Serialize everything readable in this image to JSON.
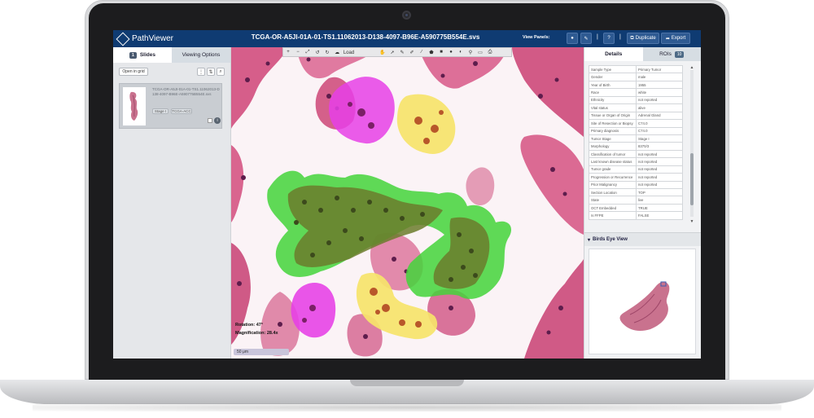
{
  "app": {
    "logo_text": "PathViewer",
    "file_title": "TCGA-OR-A5JI-01A-01-TS1.11062013-D138-4097-B96E-A590775B554E.svs",
    "view_panels_label": "View Panels:",
    "duplicate_label": "Duplicate",
    "export_label": "Export",
    "help_label": "?"
  },
  "left_panel": {
    "tabs": [
      {
        "label": "Slides",
        "badge": "1"
      },
      {
        "label": "Viewing Options"
      }
    ],
    "open_grid_label": "Open in grid",
    "slide": {
      "name": "TCGA-OR-A5JI-01A-01-TS1.11062013-D138-4097-B96E-A590775B554E.svs",
      "tags": [
        "Stage I",
        "TCGA-ACC"
      ],
      "info_icon": "info-icon"
    }
  },
  "viewer": {
    "toolbar": {
      "load_label": "Load",
      "tools": [
        "plus-icon",
        "minus-icon",
        "fit-icon",
        "rotate-left-icon",
        "rotate-right-icon",
        "cloud-icon",
        "hand-icon",
        "pointer-icon",
        "pen-icon",
        "marker-icon",
        "brush-icon",
        "polygon-icon",
        "square-icon",
        "circle-icon",
        "fill-icon",
        "pin-icon",
        "eraser-icon",
        "save-icon"
      ]
    },
    "rotation_label": "Rotation",
    "rotation_value": "47°",
    "magnification_label": "Magnification",
    "magnification_value": "28.4x",
    "scale_label": "50 μm",
    "regions": [
      {
        "color": "#e040e8",
        "name": "magenta-roi"
      },
      {
        "color": "#f5e36a",
        "name": "yellow-roi"
      },
      {
        "color": "#4ddc3a",
        "name": "green-roi"
      }
    ]
  },
  "right_panel": {
    "tabs": [
      {
        "label": "Details"
      },
      {
        "label": "ROIs",
        "badge": "10"
      }
    ],
    "metadata": [
      [
        "Sample Type",
        "Primary Tumor"
      ],
      [
        "Gender",
        "male"
      ],
      [
        "Year of Birth",
        "1955"
      ],
      [
        "Race",
        "white"
      ],
      [
        "Ethnicity",
        "not reported"
      ],
      [
        "Vital status",
        "alive"
      ],
      [
        "Tissue or Organ of Origin",
        "Adrenal Gland"
      ],
      [
        "Site of Resection or Biopsy",
        "C74.0"
      ],
      [
        "Primary diagnosis",
        "C74.0"
      ],
      [
        "Tumor Stage",
        "Stage I"
      ],
      [
        "Morphology",
        "8370/3"
      ],
      [
        "Classification of tumor",
        "not reported"
      ],
      [
        "Last known disease status",
        "not reported"
      ],
      [
        "Tumor grade",
        "not reported"
      ],
      [
        "Progression or Recurrence",
        "not reported"
      ],
      [
        "Prior Malignancy",
        "not reported"
      ],
      [
        "Section Location",
        "TOP"
      ],
      [
        "State",
        "live"
      ],
      [
        "OCT Embedded",
        "TRUE"
      ],
      [
        "Is FFPE",
        "FALSE"
      ]
    ],
    "birds_eye_label": "Birds Eye View"
  }
}
